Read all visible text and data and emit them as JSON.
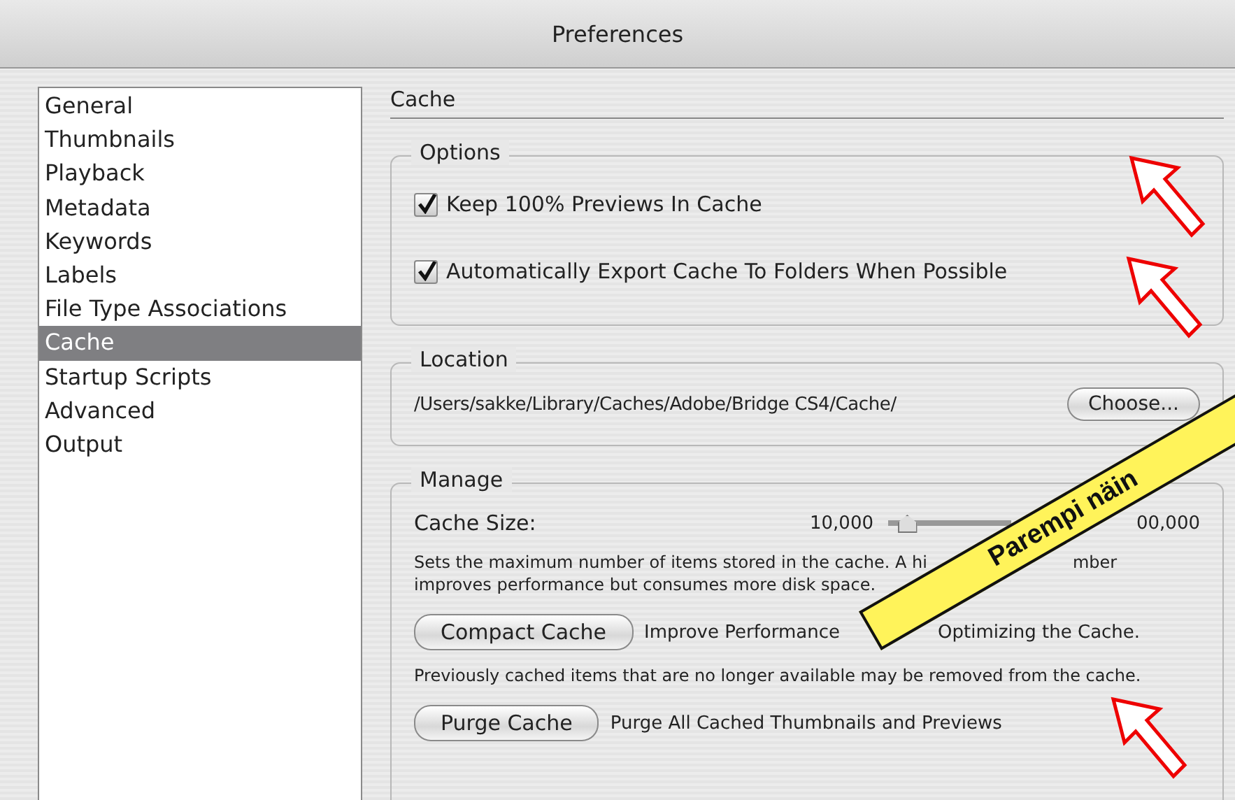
{
  "window": {
    "title": "Preferences"
  },
  "sidebar": {
    "items": [
      {
        "label": "General",
        "selected": false
      },
      {
        "label": "Thumbnails",
        "selected": false
      },
      {
        "label": "Playback",
        "selected": false
      },
      {
        "label": "Metadata",
        "selected": false
      },
      {
        "label": "Keywords",
        "selected": false
      },
      {
        "label": "Labels",
        "selected": false
      },
      {
        "label": "File Type Associations",
        "selected": false
      },
      {
        "label": "Cache",
        "selected": true
      },
      {
        "label": "Startup Scripts",
        "selected": false
      },
      {
        "label": "Advanced",
        "selected": false
      },
      {
        "label": "Output",
        "selected": false
      }
    ]
  },
  "panel": {
    "title": "Cache",
    "options": {
      "title": "Options",
      "checkboxes": [
        {
          "label": "Keep 100% Previews In Cache",
          "checked": true
        },
        {
          "label": "Automatically Export Cache To Folders When Possible",
          "checked": true
        }
      ]
    },
    "location": {
      "title": "Location",
      "path": "/Users/sakke/Library/Caches/Adobe/Bridge CS4/Cache/",
      "button": "Choose..."
    },
    "manage": {
      "title": "Manage",
      "cache_size": {
        "label": "Cache Size:",
        "min": "10,000",
        "max": "00,000",
        "level": 0.15
      },
      "description": [
        [
          "Sets the maximum number of items stored in the cache. A hi",
          "mber"
        ],
        [
          "improves performance but consumes more disk space."
        ]
      ],
      "compact": {
        "button": "Compact Cache",
        "description": [
          "Improve Performance",
          "Optimizing the Cache."
        ]
      },
      "compact_note": "Previously cached items that are no longer available may be removed from the cache.",
      "purge": {
        "button": "Purge Cache",
        "description": "Purge All Cached Thumbnails and Previews"
      }
    }
  },
  "annotation": {
    "label": "Parempi näin"
  }
}
